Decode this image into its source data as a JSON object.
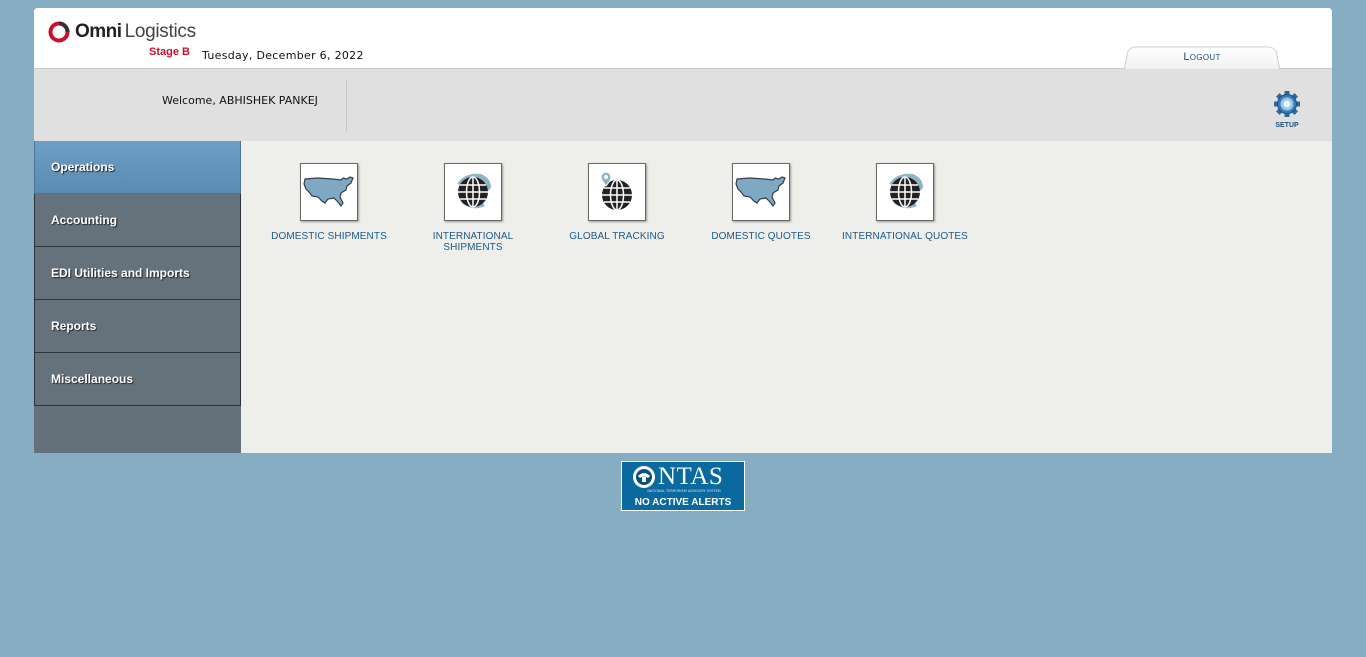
{
  "header": {
    "logo_bold": "Omni",
    "logo_light": "Logistics",
    "stage": "Stage B",
    "date": "Tuesday, December 6, 2022",
    "logout_label": "Logout"
  },
  "welcome": {
    "text": "Welcome, ABHISHEK PANKEJ",
    "setup_label": "SETUP"
  },
  "sidebar": {
    "items": [
      {
        "label": "Operations",
        "active": true
      },
      {
        "label": "Accounting"
      },
      {
        "label": "EDI Utilities and Imports"
      },
      {
        "label": "Reports"
      },
      {
        "label": "Miscellaneous"
      }
    ]
  },
  "tiles": [
    {
      "label": "DOMESTIC SHIPMENTS",
      "icon": "us-map-icon"
    },
    {
      "label": "INTERNATIONAL SHIPMENTS",
      "icon": "globe-icon"
    },
    {
      "label": "GLOBAL TRACKING",
      "icon": "globe-pin-icon"
    },
    {
      "label": "DOMESTIC QUOTES",
      "icon": "us-map-icon"
    },
    {
      "label": "INTERNATIONAL QUOTES",
      "icon": "globe-icon"
    }
  ],
  "ntas": {
    "title": "NTAS",
    "subtitle": "NATIONAL TERRORISM ADVISORY SYSTEM",
    "alert": "NO ACTIVE ALERTS"
  },
  "colors": {
    "page_bg": "#87adc2",
    "nav_bg": "#66727b",
    "nav_active": "#5f90b8",
    "link": "#1c5a8a",
    "stage_red": "#c8102e"
  }
}
